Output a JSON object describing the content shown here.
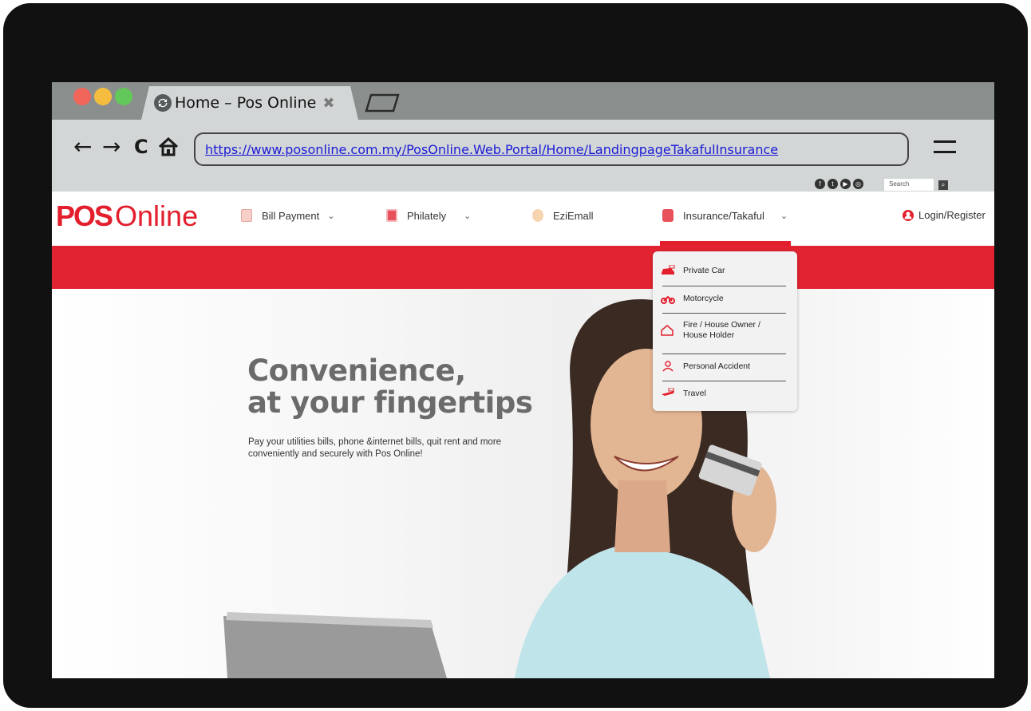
{
  "browser": {
    "tab_title": "Home – Pos Online",
    "tab_close": "✖",
    "url": "https://www.posonline.com.my/PosOnline.Web.Portal/Home/LandingpageTakafulInsurance",
    "back": "←",
    "forward": "→",
    "reload": "C",
    "home": "⌂",
    "traffic_lights": [
      "#f0645a",
      "#f4bd40",
      "#63c85a"
    ]
  },
  "site_search": {
    "placeholder": "Search"
  },
  "logo": {
    "pos": "POS",
    "online": "Online"
  },
  "nav": {
    "bill_payment": "Bill Payment",
    "philately": "Philately",
    "ezimall": "EziEmall",
    "insurance": "Insurance/Takaful",
    "login": "Login/Register",
    "chevron": "⌄"
  },
  "dropdown": {
    "items": [
      {
        "label": "Private Car"
      },
      {
        "label": "Motorcycle"
      },
      {
        "label": "Fire / House Owner / House Holder"
      },
      {
        "label": "Personal Accident"
      },
      {
        "label": "Travel"
      }
    ]
  },
  "hero": {
    "title_line1": "Convenience,",
    "title_line2": "at your fingertips",
    "subtitle": "Pay your utilities bills, phone &internet bills, quit rent and more conveniently and securely with Pos Online!"
  },
  "colors": {
    "brand_red": "#e31e2d",
    "bezel": "#111111",
    "chrome": "#d3d6d6"
  }
}
